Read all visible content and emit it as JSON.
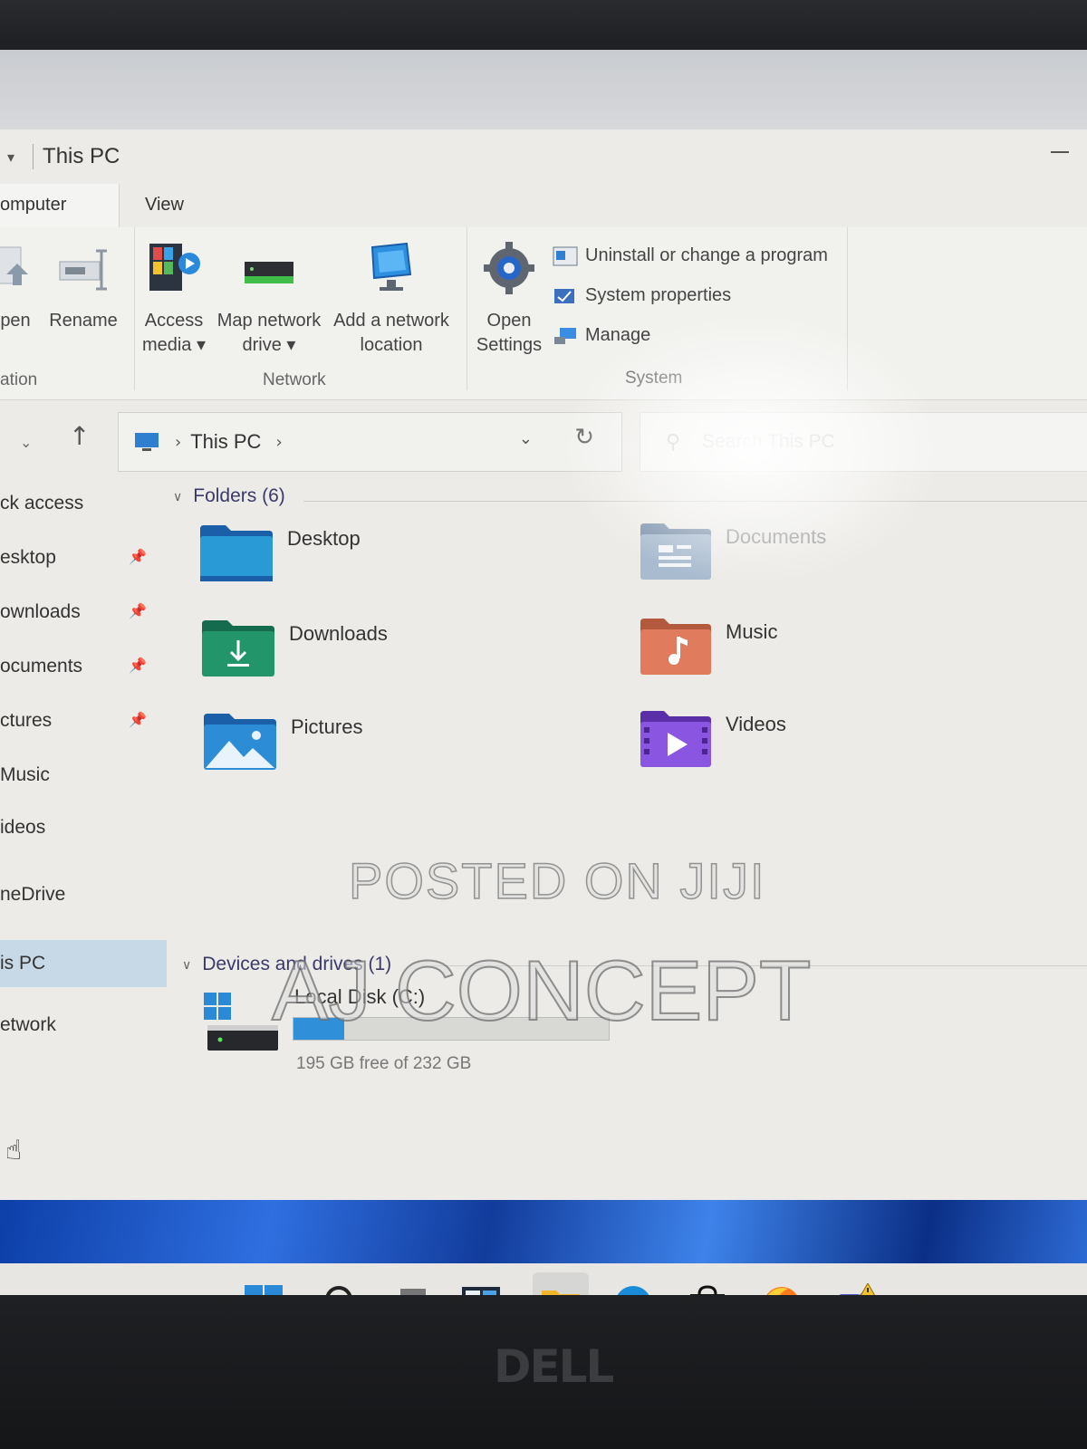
{
  "window": {
    "title": "This PC"
  },
  "tabs": {
    "computer": "omputer",
    "view": "View"
  },
  "ribbon": {
    "open_label": "pen",
    "rename_label": "Rename",
    "access_media_line1": "Access",
    "access_media_line2": "media",
    "map_drive_line1": "Map network",
    "map_drive_line2": "drive",
    "add_network_line1": "Add a network",
    "add_network_line2": "location",
    "open_settings_line1": "Open",
    "open_settings_line2": "Settings",
    "uninstall_label": "Uninstall or change a program",
    "system_properties_label": "System properties",
    "manage_label": "Manage",
    "group_location": "ation",
    "group_network": "Network",
    "group_system": "System"
  },
  "address": {
    "crumb": "This PC",
    "search_placeholder": "Search This PC"
  },
  "sidebar": {
    "items": [
      {
        "label": "ck access",
        "pinned": false
      },
      {
        "label": "esktop",
        "pinned": true
      },
      {
        "label": "ownloads",
        "pinned": true
      },
      {
        "label": "ocuments",
        "pinned": true
      },
      {
        "label": "ctures",
        "pinned": true
      },
      {
        "label": "Music",
        "pinned": false
      },
      {
        "label": "ideos",
        "pinned": false
      },
      {
        "label": "neDrive",
        "pinned": false
      },
      {
        "label": "is PC",
        "pinned": false,
        "selected": true
      },
      {
        "label": "etwork",
        "pinned": false
      }
    ]
  },
  "content": {
    "folders_header": "Folders (6)",
    "folders": [
      {
        "name": "Desktop",
        "icon": "desktop-folder-icon",
        "color": "#1f86c8"
      },
      {
        "name": "Documents",
        "icon": "documents-folder-icon",
        "color": "#8ea4bd"
      },
      {
        "name": "Downloads",
        "icon": "downloads-folder-icon",
        "color": "#1f8f6a"
      },
      {
        "name": "Music",
        "icon": "music-folder-icon",
        "color": "#d9765a"
      },
      {
        "name": "Pictures",
        "icon": "pictures-folder-icon",
        "color": "#2a86d1"
      },
      {
        "name": "Videos",
        "icon": "videos-folder-icon",
        "color": "#7b4bd6"
      }
    ],
    "devices_header": "Devices and drives (1)",
    "drives": [
      {
        "name": "Local Disk (C:)",
        "free_text": "195 GB free of 232 GB",
        "used_fraction": 0.16
      }
    ]
  },
  "watermark": {
    "line1": "POSTED ON JIJI",
    "line2": "AJ CONCEPT"
  },
  "taskbar": {
    "icons": [
      "start-icon",
      "search-icon",
      "task-view-icon",
      "widgets-icon",
      "file-explorer-icon",
      "edge-icon",
      "store-icon",
      "firefox-icon",
      "teams-icon"
    ]
  },
  "bezel": {
    "brand": "DELL"
  },
  "colors": {
    "accent": "#2f8fd8",
    "selection": "#c7d9e6"
  }
}
